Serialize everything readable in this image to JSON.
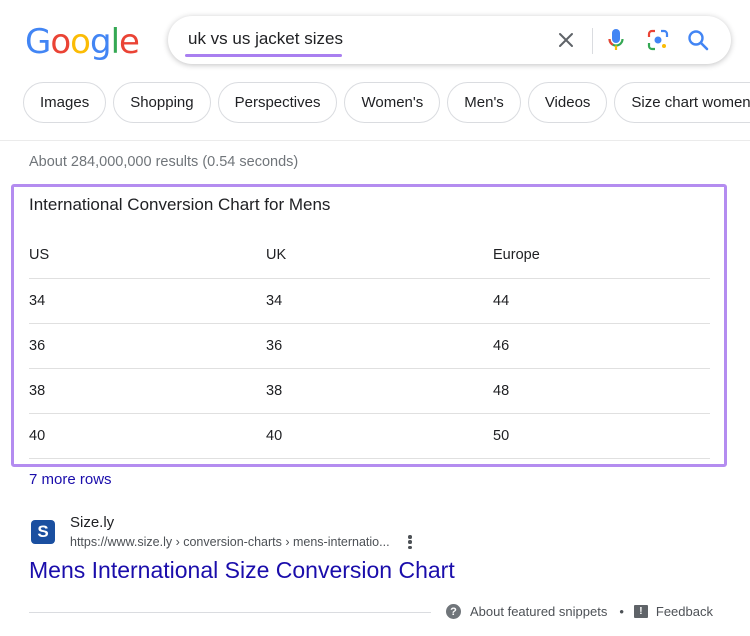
{
  "logo": {
    "text": "Google",
    "letters": [
      "G",
      "o",
      "o",
      "g",
      "l",
      "e"
    ],
    "colors": [
      "#4285F4",
      "#EA4335",
      "#FBBC05",
      "#4285F4",
      "#34A853",
      "#EA4335"
    ]
  },
  "search": {
    "query": "uk vs us jacket sizes",
    "underline_color": "#a97ff0"
  },
  "icons": {
    "clear": "close-icon",
    "voice": "microphone-icon",
    "lens": "lens-camera-icon",
    "search": "search-icon"
  },
  "chips": [
    "Images",
    "Shopping",
    "Perspectives",
    "Women's",
    "Men's",
    "Videos",
    "Size chart women's"
  ],
  "results_stats": "About 284,000,000 results (0.54 seconds)",
  "snippet": {
    "title": "International Conversion Chart for Mens",
    "highlight_color": "#b48cf0",
    "headers": [
      "US",
      "UK",
      "Europe"
    ],
    "rows": [
      [
        "34",
        "34",
        "44"
      ],
      [
        "36",
        "36",
        "46"
      ],
      [
        "38",
        "38",
        "48"
      ],
      [
        "40",
        "40",
        "50"
      ]
    ],
    "more_rows": "7 more rows"
  },
  "result": {
    "favicon_letter": "S",
    "site_name": "Size.ly",
    "url": "https://www.size.ly › conversion-charts › mens-internatio...",
    "title": "Mens International Size Conversion Chart"
  },
  "footer": {
    "about": "About featured snippets",
    "separator": "•",
    "feedback": "Feedback"
  }
}
